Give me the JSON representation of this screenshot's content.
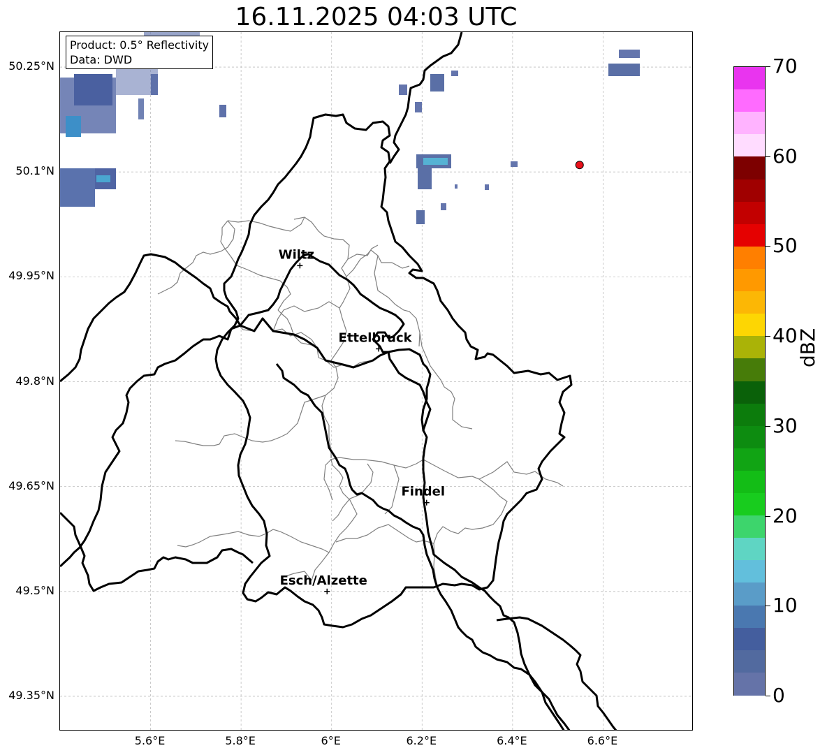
{
  "title": "16.11.2025 04:03 UTC",
  "info_box": {
    "product": "Product: 0.5° Reflectivity",
    "data": "Data: DWD"
  },
  "axes": {
    "lat_ticks": [
      "50.25°N",
      "50.1°N",
      "49.95°N",
      "49.8°N",
      "49.65°N",
      "49.5°N",
      "49.35°N"
    ],
    "lon_ticks": [
      "5.6°E",
      "5.8°E",
      "6°E",
      "6.2°E",
      "6.4°E",
      "6.6°E"
    ],
    "grid": true
  },
  "cities": [
    {
      "name": "Wiltz",
      "lon": 5.93,
      "lat": 49.966
    },
    {
      "name": "Ettelbruck",
      "lon": 6.104,
      "lat": 49.847
    },
    {
      "name": "Findel",
      "lon": 6.21,
      "lat": 49.627
    },
    {
      "name": "Esch/Alzette",
      "lon": 5.99,
      "lat": 49.5
    }
  ],
  "radar_site_marker": {
    "lon": 6.548,
    "lat": 50.11,
    "color": "#e8111b"
  },
  "colorbar": {
    "label": "dBZ",
    "min": 0,
    "max": 70,
    "tick_labels": [
      "70",
      "60",
      "50",
      "40",
      "30",
      "20",
      "10",
      "0"
    ],
    "colors_low_to_high": [
      "#6573a8",
      "#526a9f",
      "#445e9e",
      "#4a78b0",
      "#5a9cc8",
      "#62bfdc",
      "#5fd5c3",
      "#3dd56c",
      "#18cc1e",
      "#13bd16",
      "#11a414",
      "#0d8c10",
      "#0c7c0c",
      "#0a6109",
      "#477c09",
      "#aab307",
      "#fdd603",
      "#fcb705",
      "#ff9900",
      "#ff7f00",
      "#e50101",
      "#c20000",
      "#a00000",
      "#7d0000",
      "#ffdcff",
      "#ffb3ff",
      "#ff6bff",
      "#e934ef"
    ]
  },
  "colors": {
    "border_country": "#000000",
    "border_canton": "#808080",
    "echo": "#5a6fa6"
  }
}
